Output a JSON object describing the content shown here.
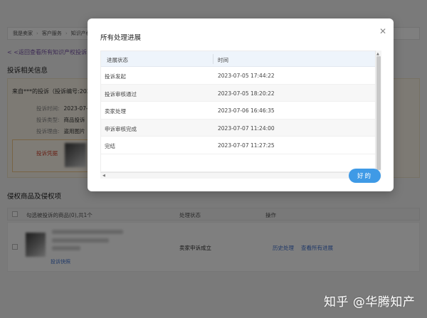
{
  "breadcrumb": [
    "我是卖家",
    "客户服务",
    "知识产权"
  ],
  "back_link": "< <返回查看所有知识产权投诉",
  "section_complaint_title": "投诉相关信息",
  "complaint": {
    "header": "来自***的投诉（投诉编号:2023",
    "fields": [
      {
        "label": "投诉时间:",
        "value": "2023-07-0"
      },
      {
        "label": "投诉类型:",
        "value": "商品投诉"
      },
      {
        "label": "投诉理由:",
        "value": "盗用图片"
      }
    ],
    "evidence_label": "投诉凭据"
  },
  "section_products_title": "侵权商品及侵权项",
  "products_table": {
    "headers": [
      "勾选被投诉的商品(0),共1个",
      "处理状态",
      "操作"
    ],
    "row": {
      "status": "卖家申诉成立",
      "actions": [
        "历史处理",
        "查看所有进展"
      ],
      "quick_link": "投诉快照"
    }
  },
  "watermark": "知乎 @华腾知产",
  "modal": {
    "title": "所有处理进展",
    "close_icon": "close-icon",
    "columns": [
      "进展状态",
      "时间"
    ],
    "rows": [
      {
        "status": "投诉发起",
        "time": "2023-07-05 17:44:22"
      },
      {
        "status": "投诉审核通过",
        "time": "2023-07-05 18:20:22"
      },
      {
        "status": "卖家处理",
        "time": "2023-07-06 16:46:35"
      },
      {
        "status": "申诉审核完成",
        "time": "2023-07-07 11:24:00"
      },
      {
        "status": "完结",
        "time": "2023-07-07 11:27:25"
      }
    ],
    "ok_label": "好的"
  },
  "colors": {
    "accent": "#3f9ae6",
    "link": "#3d6fcf",
    "back_link": "#7a56a8",
    "warning": "#d0452f"
  }
}
